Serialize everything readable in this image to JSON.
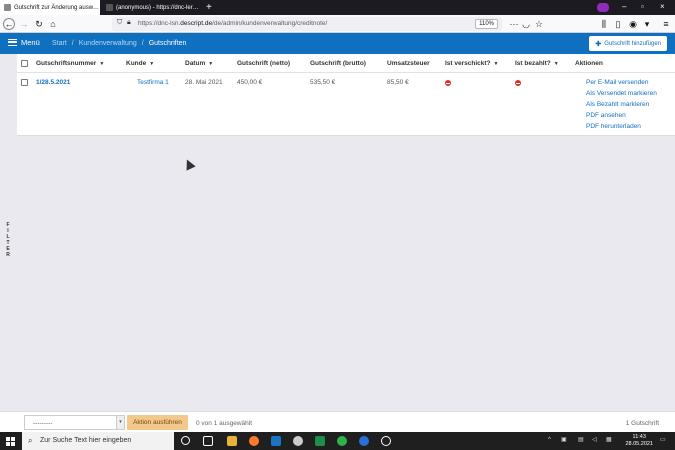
{
  "browser": {
    "tabs": [
      {
        "label": "Gutschrift zur Änderung ausw…",
        "active": true
      },
      {
        "label": "(anonymous) - https://dnc-ler…",
        "active": false
      }
    ],
    "url_prefix": "https://dnc-lsn.",
    "url_domain": "descript.de",
    "url_path": "/de/admin/kundenverwaltung/creditnote/",
    "zoom": "110%"
  },
  "app": {
    "menu_label": "Menü",
    "breadcrumbs": [
      "Start",
      "Kundenverwaltung",
      "Gutschriften"
    ],
    "add_button": "Gutschrift hinzufügen"
  },
  "table": {
    "columns": [
      "Gutschriftsnummer",
      "Kunde",
      "Datum",
      "Gutschrift (netto)",
      "Gutschrift (brutto)",
      "Umsatzsteuer",
      "Ist verschickt?",
      "Ist bezahlt?",
      "Aktionen"
    ],
    "rows": [
      {
        "number": "1/28.5.2021",
        "customer": "Testfirma 1",
        "date": "28. Mai 2021",
        "net": "450,00 €",
        "gross": "535,50 €",
        "tax": "85,50 €",
        "sent": false,
        "paid": false,
        "actions": [
          "Per E-Mail versenden",
          "Als Versendet markieren",
          "Als Bezahlt markieren",
          "PDF ansehen",
          "PDF herunterladen"
        ]
      }
    ]
  },
  "sidebar": {
    "filter_label": "FILTER"
  },
  "footer": {
    "action_select": "---------",
    "run_button": "Aktion ausführen",
    "selection_count": "0 von 1 ausgewählt",
    "total": "1 Gutschrift"
  },
  "taskbar": {
    "search_placeholder": "Zur Suche Text hier eingeben",
    "time": "11:43",
    "date": "28.05.2021"
  },
  "colors": {
    "accent": "#1070c0",
    "status_no": "#d93025",
    "run_button": "#f3c98b"
  }
}
